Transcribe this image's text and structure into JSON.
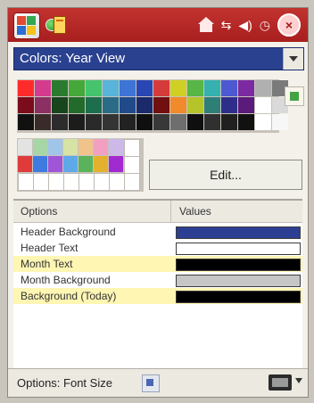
{
  "titlebar": {
    "start_icon": "windows-start-icon",
    "app_icon": "calendar-app-icon",
    "status_icons": [
      "home-icon",
      "network-icon",
      "volume-icon",
      "clock-icon"
    ],
    "close_label": "×"
  },
  "dropdown": {
    "label": "Colors: Year View"
  },
  "palette": {
    "colors_row1": [
      "#ff2b2b",
      "#d43b8f",
      "#2a7b2f",
      "#45a83a",
      "#46c46d",
      "#58b4d8",
      "#3d74d5",
      "#2a46b4",
      "#d63b3b",
      "#d0d024",
      "#57b646",
      "#35b1b0",
      "#4c59d0",
      "#7b2aa1",
      "#b0b0b0",
      "#7a7a7a"
    ],
    "colors_row2": [
      "#7a0c1b",
      "#8c2f63",
      "#17451c",
      "#226b2a",
      "#1d6e4d",
      "#2a6c87",
      "#204a8a",
      "#1a2a6b",
      "#701010",
      "#f08a2a",
      "#b4c42a",
      "#2f7f79",
      "#2e2e8a",
      "#5a1b7a",
      "#ffffff",
      "#dadada"
    ],
    "colors_row3": [
      "#111111",
      "#3a2b2b",
      "#2c2c2c",
      "#1c1c1c",
      "#2a2a2a",
      "#343434",
      "#222222",
      "#0f0f0f",
      "#383838",
      "#6e6e6e",
      "#0f0f0f",
      "#303030",
      "#202020",
      "#111111",
      "#ffffff",
      "#f7f7f7"
    ],
    "small_row1": [
      "#e3e3e3",
      "#a6d6a6",
      "#9fc6e8",
      "#d6e3a5",
      "#f0c38a",
      "#f1a0c1",
      "#cdb8ea",
      "#ffffff"
    ],
    "small_row2": [
      "#e03b3b",
      "#3d7be0",
      "#9f55d8",
      "#5ea9e8",
      "#5ab35a",
      "#e3b12d",
      "#a12bd0",
      "#ffffff"
    ],
    "small_row3": [
      "#ffffff",
      "#ffffff",
      "#ffffff",
      "#ffffff",
      "#ffffff",
      "#ffffff",
      "#ffffff",
      "#ffffff"
    ],
    "side_icon": "palette-add-icon"
  },
  "edit_button": {
    "label": "Edit..."
  },
  "table": {
    "headers": [
      "Options",
      "Values"
    ],
    "rows": [
      {
        "label": "Header Background",
        "value": "#2d3f92",
        "highlight": false
      },
      {
        "label": "Header Text",
        "value": "#ffffff",
        "highlight": false
      },
      {
        "label": "Month Text",
        "value": "#000000",
        "highlight": true
      },
      {
        "label": "Month Background",
        "value": "#c6c6c6",
        "highlight": false
      },
      {
        "label": "Background (Today)",
        "value": "#000000",
        "highlight": true
      }
    ]
  },
  "bottom": {
    "label": "Options: Font Size",
    "keyboard_icon": "keyboard-icon"
  }
}
